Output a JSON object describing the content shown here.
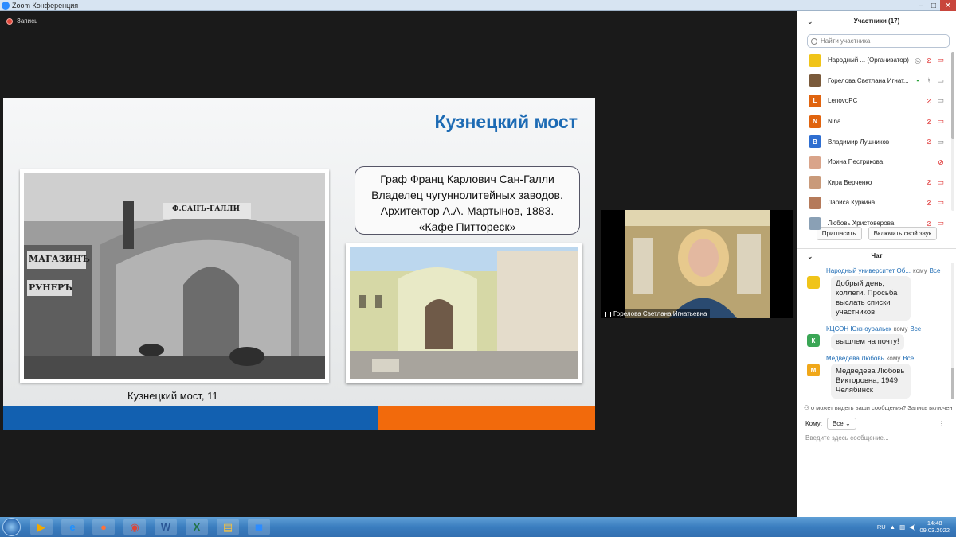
{
  "window": {
    "title": "Zoom Конференция"
  },
  "recording": {
    "label": "Запись"
  },
  "slide": {
    "title": "Кузнецкий мост",
    "caption": "Кузнецкий мост, 11",
    "info_lines": [
      "Граф Франц Карлович Сан-Галли",
      "Владелец чугуннолитейных заводов.",
      "Архитектор А.А. Мартынов, 1883.",
      "«Кафе Питтореск»"
    ],
    "old_signs": [
      "МАГАЗИНЪ",
      "РУНЕРЪ",
      "Ф.САНЪ-ГАЛЛИ"
    ]
  },
  "video": {
    "name": "Горелова Светлана Игнатьевна"
  },
  "participants": {
    "header": "Участники (17)",
    "search_placeholder": "Найти участника",
    "items": [
      {
        "name": "Народный ... (Организатор)",
        "avatar_color": "#f0c419",
        "initial": "",
        "mic": "muted",
        "cam": "off",
        "extra": "◎"
      },
      {
        "name": "Горелова Светлана Игнат...",
        "avatar_color": "#7a5a3b",
        "initial": "",
        "mic": "on",
        "cam": "on",
        "extra": "▪"
      },
      {
        "name": "LenovoPC",
        "avatar_color": "#e0640f",
        "initial": "L",
        "mic": "muted",
        "cam": "on",
        "extra": ""
      },
      {
        "name": "Nina",
        "avatar_color": "#e0640f",
        "initial": "N",
        "mic": "muted",
        "cam": "off",
        "extra": ""
      },
      {
        "name": "Владимир Лушников",
        "avatar_color": "#2f6fd1",
        "initial": "В",
        "mic": "muted",
        "cam": "on",
        "extra": ""
      },
      {
        "name": "Ирина Пестрикова",
        "avatar_color": "#d9a48a",
        "initial": "",
        "mic": "muted",
        "cam": "",
        "extra": ""
      },
      {
        "name": "Кира Верченко",
        "avatar_color": "#c99a7a",
        "initial": "",
        "mic": "muted",
        "cam": "off",
        "extra": ""
      },
      {
        "name": "Лариса Куркина",
        "avatar_color": "#b57a5a",
        "initial": "",
        "mic": "muted",
        "cam": "off",
        "extra": ""
      },
      {
        "name": "Любовь Христоверова",
        "avatar_color": "#8aa0b5",
        "initial": "",
        "mic": "muted",
        "cam": "off",
        "extra": ""
      }
    ],
    "invite_label": "Пригласить",
    "unmute_label": "Включить свой звук"
  },
  "chat": {
    "header": "Чат",
    "to_word": "кому",
    "messages": [
      {
        "from": "Народный университет Об...",
        "to": "Все",
        "text": "Добрый день, коллеги. Просьба выслать списки участников",
        "avatar_color": "#f0c419",
        "initial": ""
      },
      {
        "from": "КЦСОН Южноуральск",
        "to": "Все",
        "text": "вышлем на почту!",
        "avatar_color": "#3aa655",
        "initial": "К"
      },
      {
        "from": "Медведева Любовь",
        "to": "Все",
        "text": "Медведева Любовь Викторовна, 1949 Челябинск",
        "avatar_color": "#f0a719",
        "initial": "М"
      }
    ],
    "notice": "о может видеть ваши сообщения? Запись включен",
    "to_label": "Кому:",
    "to_value": "Все",
    "input_placeholder": "Введите здесь сообщение..."
  },
  "taskbar": {
    "lang": "RU",
    "time": "14:48",
    "date": "09.03.2022",
    "apps": [
      {
        "name": "media-player-icon",
        "glyph": "▶",
        "color": "#f2a900"
      },
      {
        "name": "ie-icon",
        "glyph": "e",
        "color": "#1e90ff"
      },
      {
        "name": "firefox-icon",
        "glyph": "●",
        "color": "#ff7139"
      },
      {
        "name": "chrome-icon",
        "glyph": "◉",
        "color": "#db4437"
      },
      {
        "name": "word-icon",
        "glyph": "W",
        "color": "#2b5797"
      },
      {
        "name": "excel-icon",
        "glyph": "X",
        "color": "#217346"
      },
      {
        "name": "explorer-icon",
        "glyph": "▤",
        "color": "#f5c242"
      },
      {
        "name": "zoom-icon",
        "glyph": "◼",
        "color": "#2d8cff"
      }
    ]
  }
}
